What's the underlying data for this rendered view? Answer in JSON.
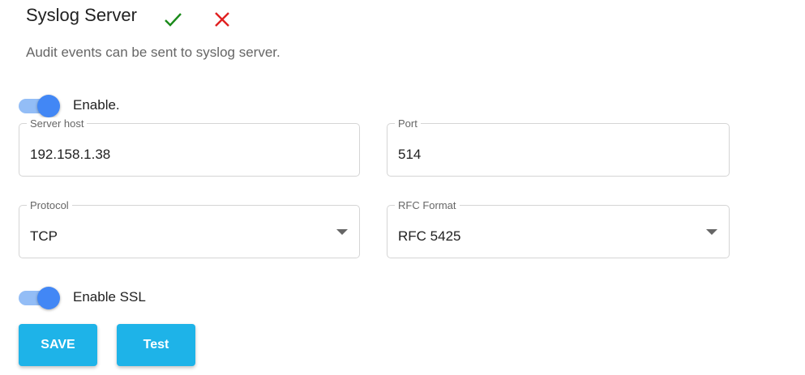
{
  "header": {
    "title": "Syslog Server",
    "confirm_icon": "check-icon",
    "cancel_icon": "close-icon",
    "confirm_color": "#1a8a1a",
    "cancel_color": "#e02020",
    "description": "Audit events can be sent to syslog server."
  },
  "enable_toggle": {
    "label": "Enable.",
    "on": true
  },
  "fields": {
    "server_host": {
      "label": "Server host",
      "value": "192.158.1.38"
    },
    "port": {
      "label": "Port",
      "value": "514"
    },
    "protocol": {
      "label": "Protocol",
      "value": "TCP"
    },
    "rfc_format": {
      "label": "RFC Format",
      "value": "RFC 5425"
    }
  },
  "ssl_toggle": {
    "label": "Enable SSL",
    "on": true
  },
  "buttons": {
    "save": "SAVE",
    "test": "Test"
  },
  "colors": {
    "accent": "#4287f5",
    "button": "#1eb3e8"
  }
}
